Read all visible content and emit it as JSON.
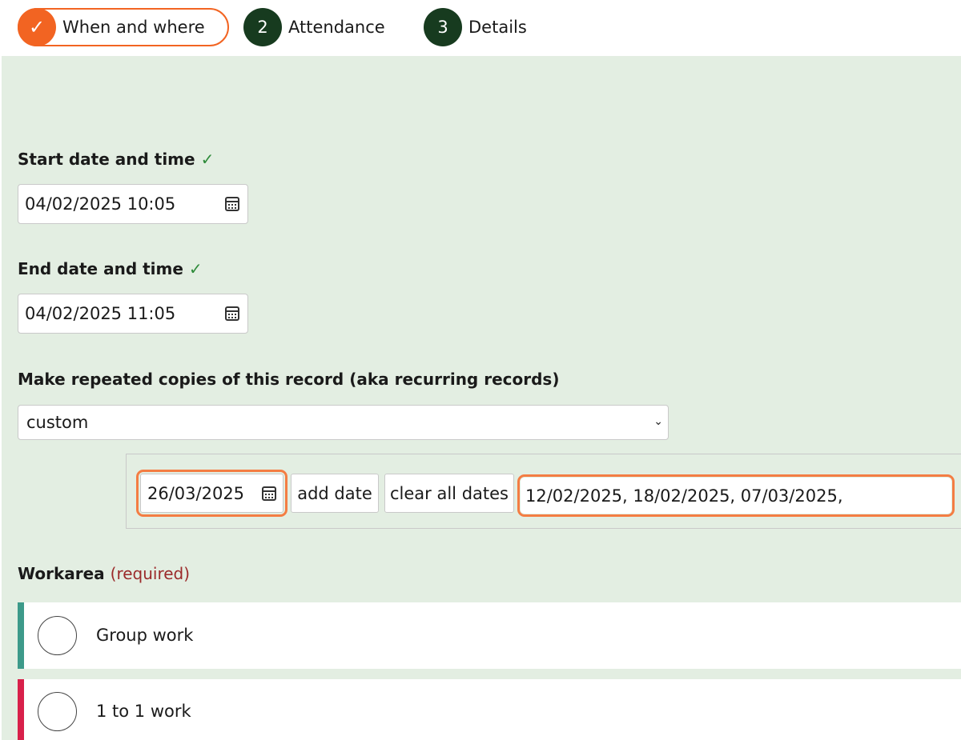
{
  "stepper": {
    "steps": [
      {
        "marker": "✓",
        "label": "When and where",
        "state": "complete"
      },
      {
        "marker": "2",
        "label": "Attendance",
        "state": "pending"
      },
      {
        "marker": "3",
        "label": "Details",
        "state": "pending"
      }
    ]
  },
  "start": {
    "label": "Start date and time",
    "tick": "✓",
    "value": "04/02/2025 10:05"
  },
  "end": {
    "label": "End date and time",
    "tick": "✓",
    "value": "04/02/2025 11:05"
  },
  "recurring": {
    "label": "Make repeated copies of this record (aka recurring records)",
    "selected": "custom",
    "chevron": "⌄",
    "date_input": "26/03/2025",
    "add_label": "add date",
    "clear_label": "clear all dates",
    "dates_list": "12/02/2025, 18/02/2025, 07/03/2025,"
  },
  "workarea": {
    "label": "Workarea",
    "required": "(required)",
    "options": [
      {
        "label": "Group work",
        "accent": "#3d9a8a"
      },
      {
        "label": "1 to 1 work",
        "accent": "#d8204a"
      }
    ]
  },
  "colors": {
    "accent_orange": "#f26422",
    "dark_green": "#173b1f",
    "panel_bg": "#e3eee2",
    "highlight": "#f47d43"
  },
  "icons": [
    "check-icon",
    "calendar-icon",
    "chevron-down-icon",
    "radio-circle-icon"
  ]
}
